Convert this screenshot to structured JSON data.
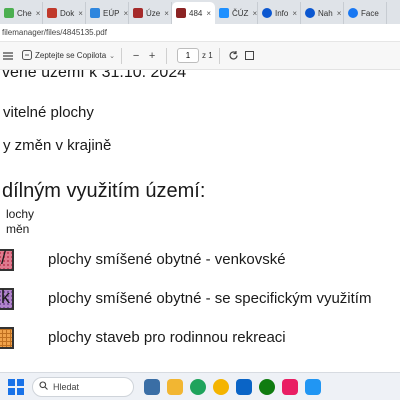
{
  "tabs": [
    {
      "label": "Che",
      "icon": "chrome-icon",
      "color": "#4caf50"
    },
    {
      "label": "Dok",
      "icon": "document-icon",
      "color": "#c0392b"
    },
    {
      "label": "EÚP",
      "icon": "globe-icon",
      "color": "#2e86de"
    },
    {
      "label": "Úze",
      "icon": "map-icon",
      "color": "#a52a2a"
    },
    {
      "label": "484",
      "icon": "pdf-icon",
      "color": "#8b2323",
      "active": true
    },
    {
      "label": "ČÚZ",
      "icon": "globe-icon",
      "color": "#1e90ff"
    },
    {
      "label": "Info",
      "icon": "copilot-icon",
      "color": "#0b57d0"
    },
    {
      "label": "Nah",
      "icon": "copilot-icon",
      "color": "#0b57d0"
    },
    {
      "label": "Face",
      "icon": "facebook-icon",
      "color": "#1877f2"
    }
  ],
  "address": {
    "url": "filemanager/files/4845135.pdf"
  },
  "pdf_toolbar": {
    "copilot_label": "Zeptejte se Copilota",
    "page_current": "1",
    "page_total": "z 1"
  },
  "document": {
    "line1": "věné území k 31.10. 2024",
    "line2": "vitelné plochy",
    "line3": "y změn v krajině",
    "heading": "dílným využitím území:",
    "sub1": "lochy",
    "sub2": "měn",
    "legend": [
      {
        "label": "plochy smíšené obytné - venkovské",
        "letter": "/",
        "color": "#e07a8e"
      },
      {
        "label": "plochy smíšené obytné - se specifickým využitím",
        "letter": "k",
        "color": "#b084c9"
      },
      {
        "label": "plochy staveb pro rodinnou rekreaci",
        "letter": "",
        "color": "#f0a24a"
      }
    ]
  },
  "taskbar": {
    "search_placeholder": "Hledat",
    "apps": [
      {
        "name": "news-icon",
        "color": "#3a6ea5"
      },
      {
        "name": "file-explorer-icon",
        "color": "#f2b632"
      },
      {
        "name": "edge-icon",
        "color": "#1fa35c"
      },
      {
        "name": "chrome-icon",
        "color": "#f4b400"
      },
      {
        "name": "outlook-icon",
        "color": "#0a64c6"
      },
      {
        "name": "xbox-icon",
        "color": "#107c10"
      },
      {
        "name": "paint-icon",
        "color": "#e91e63"
      },
      {
        "name": "photos-icon",
        "color": "#2196f3"
      }
    ]
  }
}
